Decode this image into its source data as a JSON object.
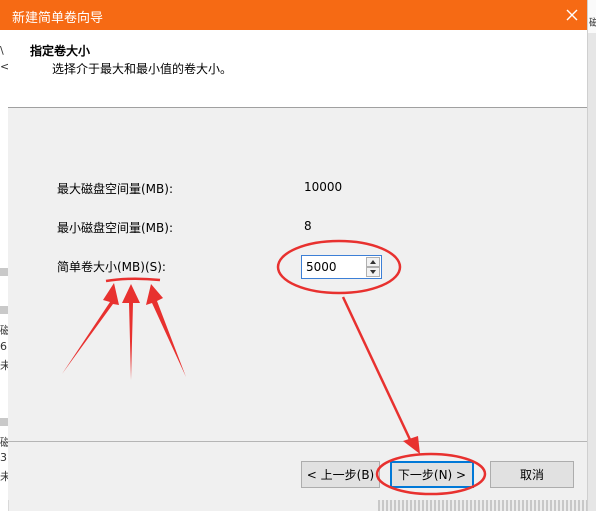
{
  "window": {
    "title": "新建简单卷向导",
    "close_glyph": "✕"
  },
  "header": {
    "title": "指定卷大小",
    "subtitle": "选择介于最大和最小值的卷大小。"
  },
  "fields": {
    "max_label": "最大磁盘空间量(MB):",
    "max_value": "10000",
    "min_label": "最小磁盘空间量(MB):",
    "min_value": "8",
    "size_label": "简单卷大小(MB)(S):",
    "size_value": "5000"
  },
  "buttons": {
    "back": "< 上一步(B)",
    "next": "下一步(N) >",
    "cancel": "取消"
  },
  "background": {
    "right_fragment": "磁",
    "left_fragments": [
      "\\",
      "<",
      "磁",
      "6",
      "未",
      "磁",
      "3",
      "未"
    ]
  },
  "colors": {
    "titlebar": "#f66a14",
    "annotation": "#e8312f",
    "focus": "#0078d7"
  },
  "icons": {
    "close": "close-icon",
    "spin_up": "up-arrow-icon",
    "spin_down": "down-arrow-icon"
  }
}
